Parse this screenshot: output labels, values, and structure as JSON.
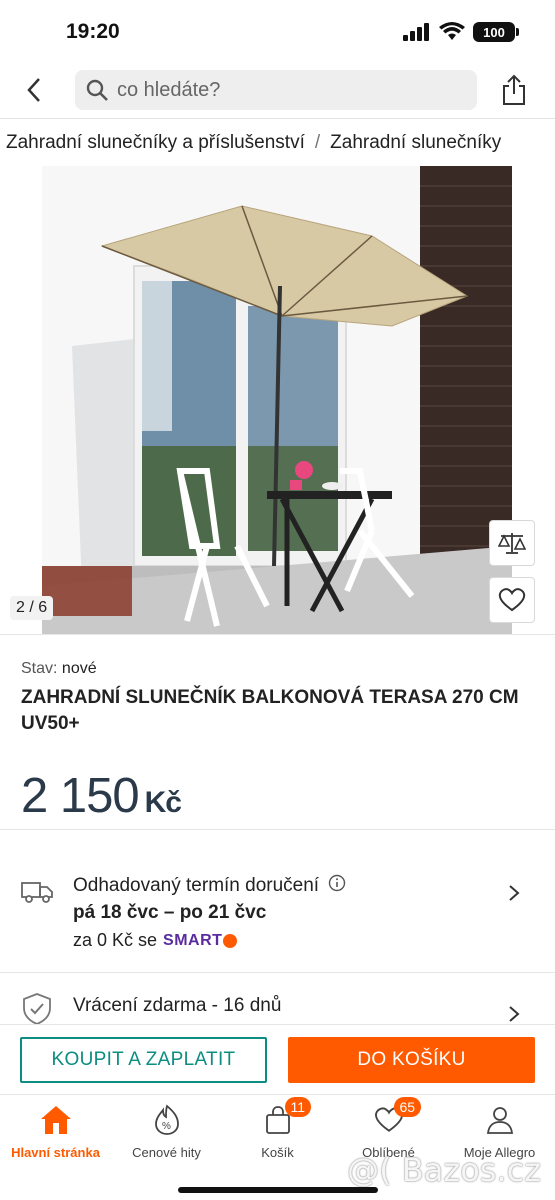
{
  "status_bar": {
    "time": "19:20",
    "battery": "100"
  },
  "search": {
    "placeholder": "co hledáte?"
  },
  "breadcrumb": {
    "items": [
      "Zahradní slunečníky a příslušenství",
      "Zahradní slunečníky"
    ],
    "separator": "/"
  },
  "gallery": {
    "counter": "2 / 6"
  },
  "product": {
    "condition_label": "Stav:",
    "condition_value": "nové",
    "title": "ZAHRADNÍ SLUNEČNÍK BALKONOVÁ TERASA 270 CM UV50+",
    "price": "2 150",
    "currency": "Kč"
  },
  "delivery": {
    "title": "Odhadovaný termín doručení",
    "dates": "pá 18 čvc – po 21 čvc",
    "cost": "za 0 Kč se",
    "smart_label": "SMART"
  },
  "returns": {
    "title": "Vrácení zdarma - 16 dnů"
  },
  "actions": {
    "buy": "KOUPIT A ZAPLATIT",
    "cart": "DO KOŠÍKU"
  },
  "tabs": [
    {
      "label": "Hlavní stránka",
      "icon": "home-icon",
      "active": true
    },
    {
      "label": "Cenové hity",
      "icon": "discount-icon"
    },
    {
      "label": "Košík",
      "icon": "cart-icon",
      "badge": "11"
    },
    {
      "label": "Oblíbené",
      "icon": "heart-icon",
      "badge": "65"
    },
    {
      "label": "Moje Allegro",
      "icon": "user-icon"
    }
  ],
  "watermark": "@( Bazos.cz",
  "colors": {
    "accent": "#ff5a00",
    "teal": "#0b8d80",
    "smart": "#5a2ca0"
  }
}
